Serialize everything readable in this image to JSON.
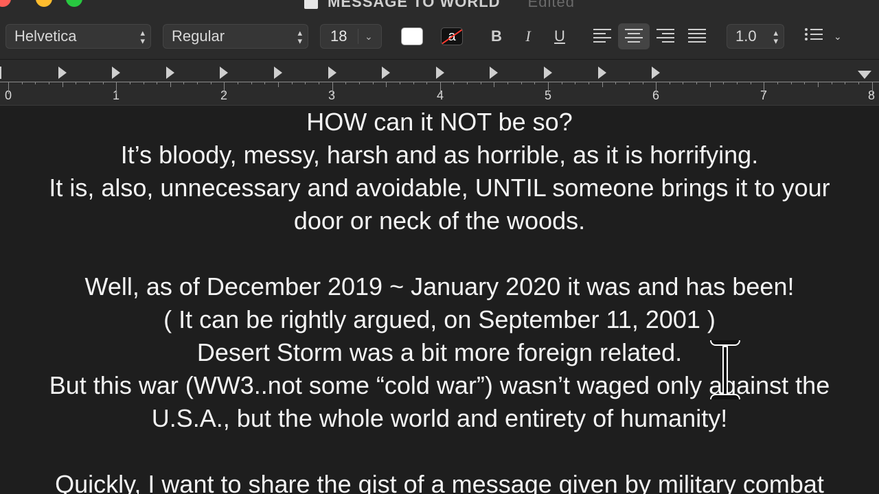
{
  "window": {
    "title": "MESSAGE TO WORLD",
    "status": "Edited"
  },
  "toolbar": {
    "font_family": "Helvetica",
    "font_style": "Regular",
    "font_size": "18",
    "bold_label": "B",
    "italic_label": "I",
    "underline_label": "U",
    "highlight_letter": "a",
    "line_spacing": "1.0",
    "text_color": "#ffffff",
    "alignment_selected": "center"
  },
  "ruler": {
    "numbers": [
      "0",
      "1",
      "2",
      "3",
      "4",
      "5",
      "6",
      "7",
      "8"
    ]
  },
  "document": {
    "lines": [
      "HOW can it NOT be so?",
      "It’s bloody, messy, harsh and as horrible, as it is horrifying.",
      "It is, also, unnecessary and avoidable, UNTIL someone brings it to your",
      "door or neck of the woods.",
      "",
      "Well, as of December 2019 ~ January 2020 it was and has been!",
      "( It can be rightly argued, on September 11, 2001 )",
      "Desert Storm was a bit more foreign related.",
      "But this war (WW3..not some “cold war”) wasn’t waged only against the",
      "U.S.A., but the whole world and entirety of humanity!",
      "",
      "Quickly, I want to share the gist of a message given by military combat"
    ]
  }
}
